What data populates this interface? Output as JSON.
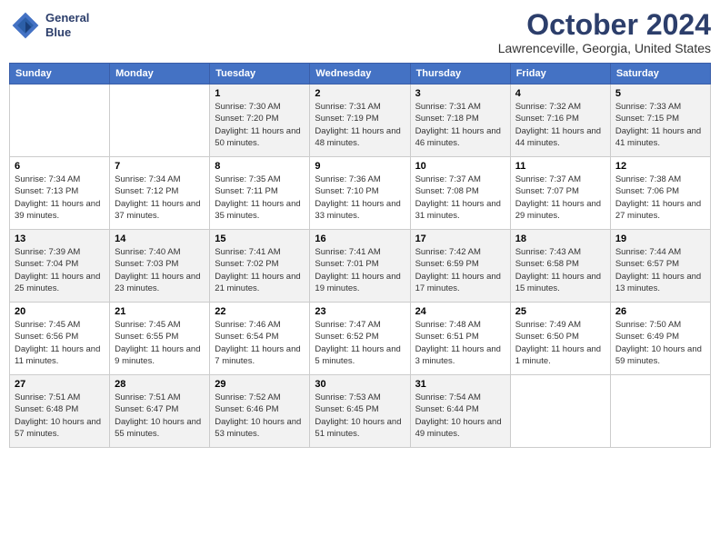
{
  "logo": {
    "line1": "General",
    "line2": "Blue"
  },
  "header": {
    "title": "October 2024",
    "location": "Lawrenceville, Georgia, United States"
  },
  "weekdays": [
    "Sunday",
    "Monday",
    "Tuesday",
    "Wednesday",
    "Thursday",
    "Friday",
    "Saturday"
  ],
  "weeks": [
    [
      null,
      null,
      {
        "day": 1,
        "sunrise": "7:30 AM",
        "sunset": "7:20 PM",
        "daylight": "11 hours and 50 minutes."
      },
      {
        "day": 2,
        "sunrise": "7:31 AM",
        "sunset": "7:19 PM",
        "daylight": "11 hours and 48 minutes."
      },
      {
        "day": 3,
        "sunrise": "7:31 AM",
        "sunset": "7:18 PM",
        "daylight": "11 hours and 46 minutes."
      },
      {
        "day": 4,
        "sunrise": "7:32 AM",
        "sunset": "7:16 PM",
        "daylight": "11 hours and 44 minutes."
      },
      {
        "day": 5,
        "sunrise": "7:33 AM",
        "sunset": "7:15 PM",
        "daylight": "11 hours and 41 minutes."
      }
    ],
    [
      {
        "day": 6,
        "sunrise": "7:34 AM",
        "sunset": "7:13 PM",
        "daylight": "11 hours and 39 minutes."
      },
      {
        "day": 7,
        "sunrise": "7:34 AM",
        "sunset": "7:12 PM",
        "daylight": "11 hours and 37 minutes."
      },
      {
        "day": 8,
        "sunrise": "7:35 AM",
        "sunset": "7:11 PM",
        "daylight": "11 hours and 35 minutes."
      },
      {
        "day": 9,
        "sunrise": "7:36 AM",
        "sunset": "7:10 PM",
        "daylight": "11 hours and 33 minutes."
      },
      {
        "day": 10,
        "sunrise": "7:37 AM",
        "sunset": "7:08 PM",
        "daylight": "11 hours and 31 minutes."
      },
      {
        "day": 11,
        "sunrise": "7:37 AM",
        "sunset": "7:07 PM",
        "daylight": "11 hours and 29 minutes."
      },
      {
        "day": 12,
        "sunrise": "7:38 AM",
        "sunset": "7:06 PM",
        "daylight": "11 hours and 27 minutes."
      }
    ],
    [
      {
        "day": 13,
        "sunrise": "7:39 AM",
        "sunset": "7:04 PM",
        "daylight": "11 hours and 25 minutes."
      },
      {
        "day": 14,
        "sunrise": "7:40 AM",
        "sunset": "7:03 PM",
        "daylight": "11 hours and 23 minutes."
      },
      {
        "day": 15,
        "sunrise": "7:41 AM",
        "sunset": "7:02 PM",
        "daylight": "11 hours and 21 minutes."
      },
      {
        "day": 16,
        "sunrise": "7:41 AM",
        "sunset": "7:01 PM",
        "daylight": "11 hours and 19 minutes."
      },
      {
        "day": 17,
        "sunrise": "7:42 AM",
        "sunset": "6:59 PM",
        "daylight": "11 hours and 17 minutes."
      },
      {
        "day": 18,
        "sunrise": "7:43 AM",
        "sunset": "6:58 PM",
        "daylight": "11 hours and 15 minutes."
      },
      {
        "day": 19,
        "sunrise": "7:44 AM",
        "sunset": "6:57 PM",
        "daylight": "11 hours and 13 minutes."
      }
    ],
    [
      {
        "day": 20,
        "sunrise": "7:45 AM",
        "sunset": "6:56 PM",
        "daylight": "11 hours and 11 minutes."
      },
      {
        "day": 21,
        "sunrise": "7:45 AM",
        "sunset": "6:55 PM",
        "daylight": "11 hours and 9 minutes."
      },
      {
        "day": 22,
        "sunrise": "7:46 AM",
        "sunset": "6:54 PM",
        "daylight": "11 hours and 7 minutes."
      },
      {
        "day": 23,
        "sunrise": "7:47 AM",
        "sunset": "6:52 PM",
        "daylight": "11 hours and 5 minutes."
      },
      {
        "day": 24,
        "sunrise": "7:48 AM",
        "sunset": "6:51 PM",
        "daylight": "11 hours and 3 minutes."
      },
      {
        "day": 25,
        "sunrise": "7:49 AM",
        "sunset": "6:50 PM",
        "daylight": "11 hours and 1 minute."
      },
      {
        "day": 26,
        "sunrise": "7:50 AM",
        "sunset": "6:49 PM",
        "daylight": "10 hours and 59 minutes."
      }
    ],
    [
      {
        "day": 27,
        "sunrise": "7:51 AM",
        "sunset": "6:48 PM",
        "daylight": "10 hours and 57 minutes."
      },
      {
        "day": 28,
        "sunrise": "7:51 AM",
        "sunset": "6:47 PM",
        "daylight": "10 hours and 55 minutes."
      },
      {
        "day": 29,
        "sunrise": "7:52 AM",
        "sunset": "6:46 PM",
        "daylight": "10 hours and 53 minutes."
      },
      {
        "day": 30,
        "sunrise": "7:53 AM",
        "sunset": "6:45 PM",
        "daylight": "10 hours and 51 minutes."
      },
      {
        "day": 31,
        "sunrise": "7:54 AM",
        "sunset": "6:44 PM",
        "daylight": "10 hours and 49 minutes."
      },
      null,
      null
    ]
  ]
}
